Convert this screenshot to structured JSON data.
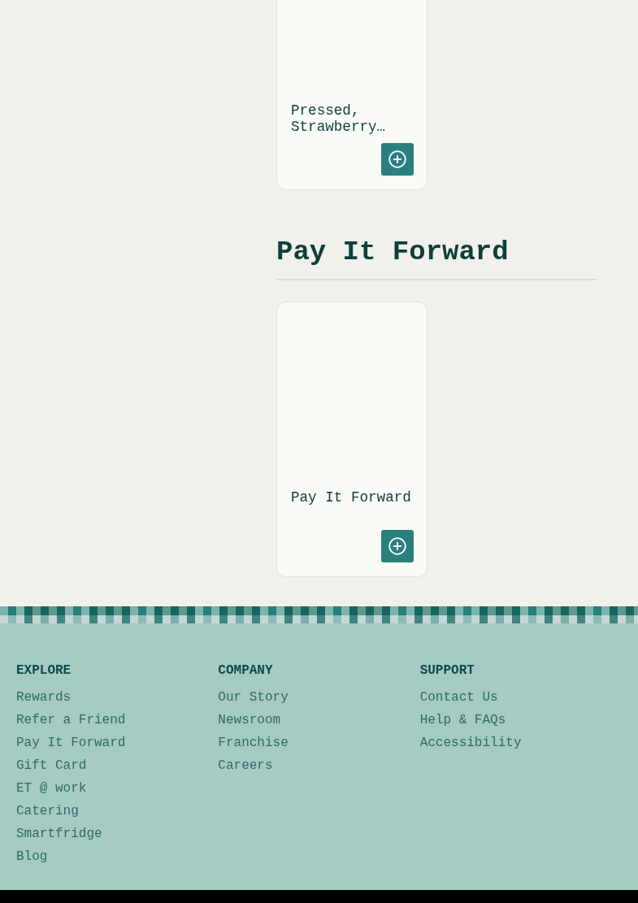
{
  "sections": [
    {
      "cards": [
        {
          "title": "Pressed, Strawberry…"
        }
      ]
    },
    {
      "heading": "Pay It Forward",
      "cards": [
        {
          "title": "Pay It Forward"
        }
      ]
    }
  ],
  "footer": {
    "columns": [
      {
        "heading": "EXPLORE",
        "links": [
          "Rewards",
          "Refer a Friend",
          "Pay It Forward",
          "Gift Card",
          "ET @ work",
          "Catering",
          "Smartfridge",
          "Blog"
        ]
      },
      {
        "heading": "COMPANY",
        "links": [
          "Our Story",
          "Newsroom",
          "Franchise",
          "Careers"
        ]
      },
      {
        "heading": "SUPPORT",
        "links": [
          "Contact Us",
          "Help & FAQs",
          "Accessibility"
        ]
      }
    ]
  }
}
